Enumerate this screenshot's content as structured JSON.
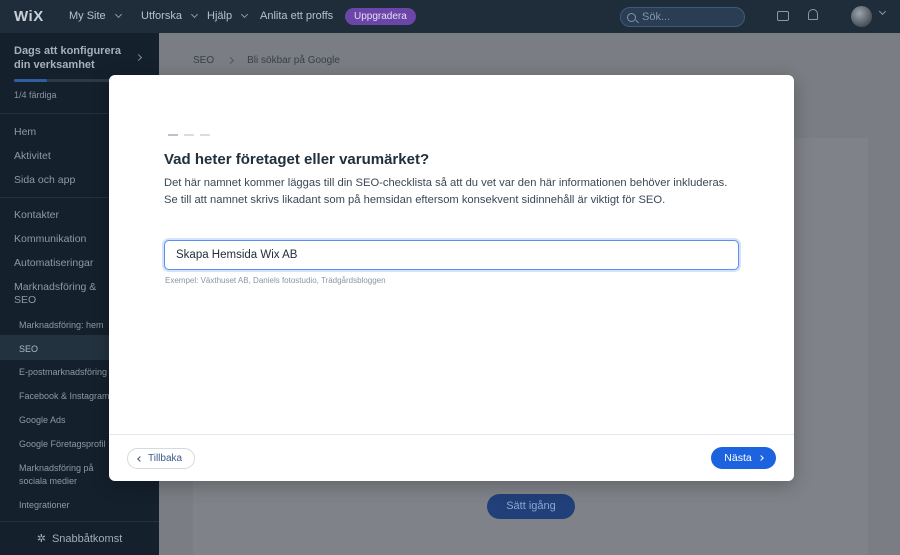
{
  "topbar": {
    "logo": "WiX",
    "my_site": "My Site",
    "explore": "Utforska",
    "help": "Hjälp",
    "hire": "Anlita ett proffs",
    "upgrade": "Uppgradera",
    "search_placeholder": "Sök..."
  },
  "sidebar": {
    "setup_title": "Dags att konfigurera din verksamhet",
    "progress_text": "1/4 färdiga",
    "progress_fraction": 0.25,
    "items": {
      "home": "Hem",
      "activity": "Aktivitet",
      "site_app": "Sida och app",
      "contacts": "Kontakter",
      "communication": "Kommunikation",
      "automations": "Automatiseringar",
      "marketing": "Marknadsföring & SEO",
      "marketing_home": "Marknadsföring: hem",
      "seo": "SEO",
      "email": "E-postmarknadsföring",
      "facebook": "Facebook & Instagram",
      "google_ads": "Google Ads",
      "google_profile": "Google Företagsprofil",
      "social": "Marknadsföring på sociala medier",
      "integrations": "Integrationer"
    },
    "quick_access": "Snabbåtkomst"
  },
  "main": {
    "breadcrumb_1": "SEO",
    "breadcrumb_2": "Bli sökbar på Google",
    "start_button": "Sätt igång"
  },
  "modal": {
    "title": "Vad heter företaget eller varumärket?",
    "description": "Det här namnet kommer läggas till din SEO-checklista så att du vet var den här informationen behöver inkluderas. Se till att namnet skrivs likadant som på hemsidan eftersom konsekvent sidinnehåll är viktigt för SEO.",
    "input_value": "Skapa Hemsida Wix AB",
    "example": "Exempel: Växthuset AB, Daniels fotostudio, Trädgårdsbloggen",
    "back": "Tillbaka",
    "next": "Nästa"
  }
}
